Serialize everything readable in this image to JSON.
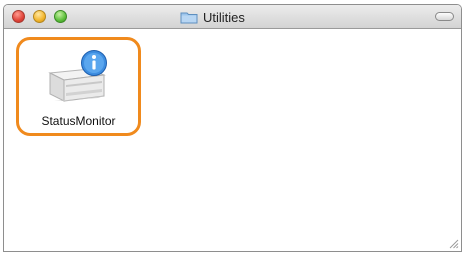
{
  "window": {
    "title": "Utilities"
  },
  "items": [
    {
      "label": "StatusMonitor",
      "icon": "printer-info-icon",
      "selected": true
    }
  ],
  "colors": {
    "selection_border": "#f08a1d",
    "info_badge": "#3d8de0"
  }
}
